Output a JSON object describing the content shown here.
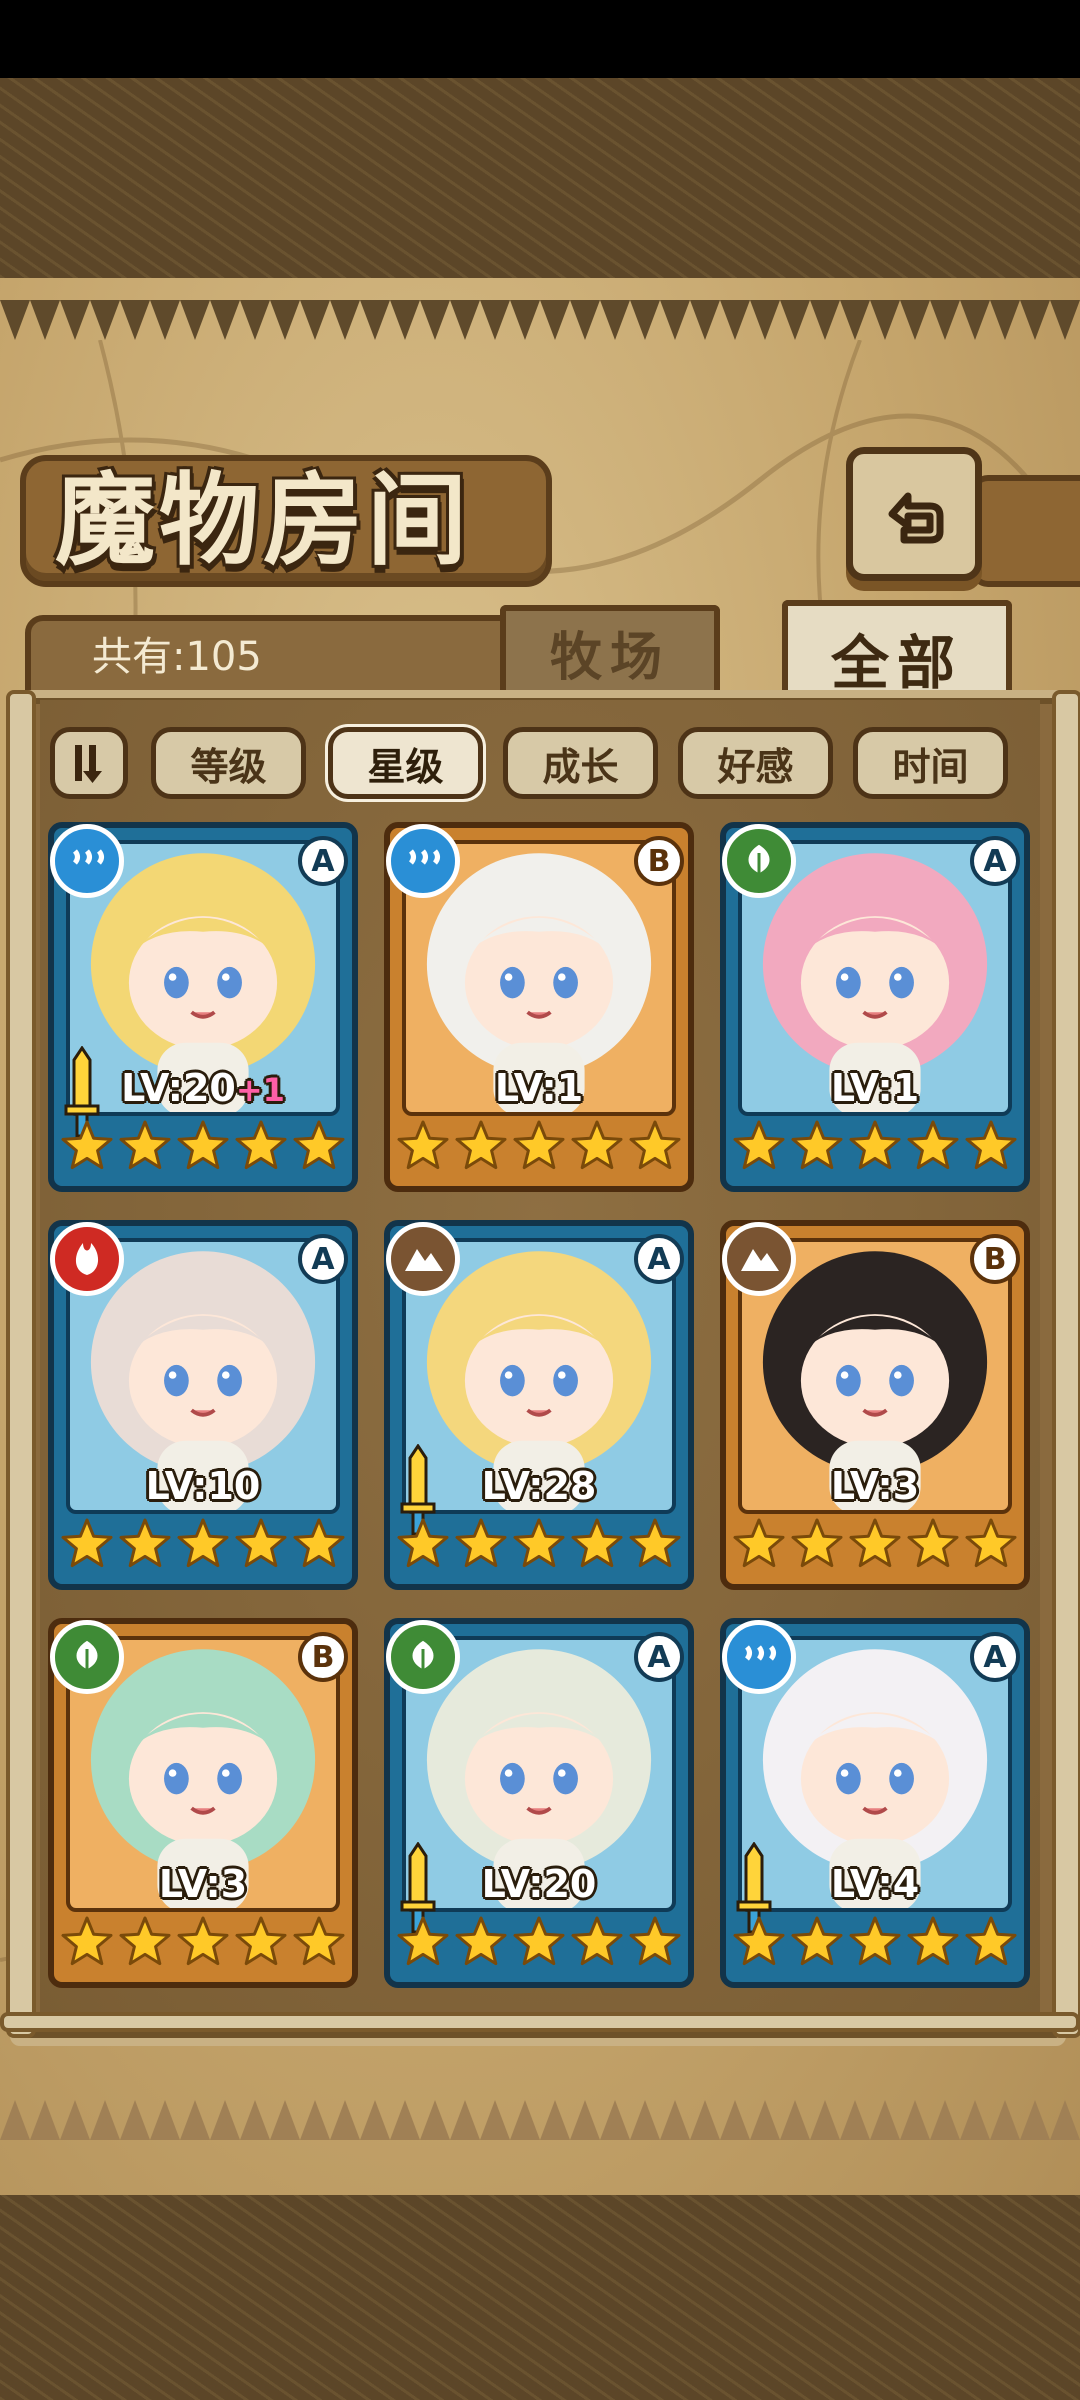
{
  "screen": {
    "title": "魔物房间",
    "total_count": "共有:105"
  },
  "tabs": [
    {
      "label": "牧场",
      "selected": false
    },
    {
      "label": "全部",
      "selected": true
    }
  ],
  "sort_buttons": [
    {
      "label": "等级",
      "selected": false
    },
    {
      "label": "星级",
      "selected": true
    },
    {
      "label": "成长",
      "selected": false
    },
    {
      "label": "好感",
      "selected": false
    },
    {
      "label": "时间",
      "selected": false
    }
  ],
  "colors": {
    "blue_frame": "#1f6f98",
    "orange_frame": "#c9812e",
    "star": "#ffc928",
    "bonus": "#ff5fa6"
  },
  "monsters": [
    {
      "element": "water",
      "rank": "A",
      "frame": "blue",
      "level": "LV:20",
      "bonus": "+1",
      "stars": 5,
      "sword": true,
      "hair": "#f3d774"
    },
    {
      "element": "water",
      "rank": "B",
      "frame": "orange",
      "level": "LV:1",
      "bonus": "",
      "stars": 5,
      "sword": false,
      "hair": "#f1f0ec"
    },
    {
      "element": "earth",
      "rank": "A",
      "frame": "blue",
      "level": "LV:1",
      "bonus": "",
      "stars": 5,
      "sword": false,
      "hair": "#f2a9bf"
    },
    {
      "element": "fire",
      "rank": "A",
      "frame": "blue",
      "level": "LV:10",
      "bonus": "",
      "stars": 5,
      "sword": false,
      "hair": "#e8dcd6"
    },
    {
      "element": "rock",
      "rank": "A",
      "frame": "blue",
      "level": "LV:28",
      "bonus": "",
      "stars": 5,
      "sword": true,
      "hair": "#f4d77d"
    },
    {
      "element": "rock",
      "rank": "B",
      "frame": "orange",
      "level": "LV:3",
      "bonus": "",
      "stars": 5,
      "sword": false,
      "hair": "#2b2422"
    },
    {
      "element": "earth",
      "rank": "B",
      "frame": "orange",
      "level": "LV:3",
      "bonus": "",
      "stars": 5,
      "sword": false,
      "hair": "#a8dcc4"
    },
    {
      "element": "earth",
      "rank": "A",
      "frame": "blue",
      "level": "LV:20",
      "bonus": "",
      "stars": 5,
      "sword": true,
      "hair": "#e6eadc"
    },
    {
      "element": "water",
      "rank": "A",
      "frame": "blue",
      "level": "LV:4",
      "bonus": "",
      "stars": 5,
      "sword": true,
      "hair": "#f3f1f4"
    }
  ]
}
